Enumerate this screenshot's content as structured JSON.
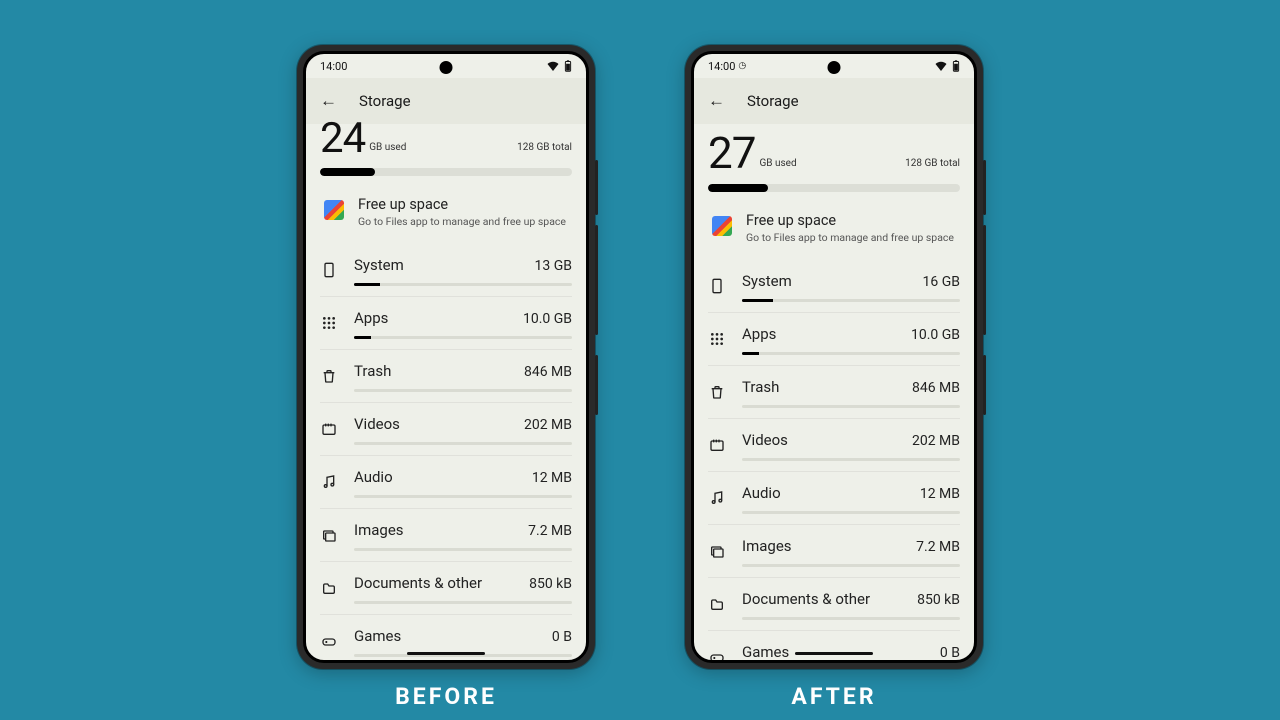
{
  "labels": {
    "before": "BEFORE",
    "after": "AFTER"
  },
  "phones": {
    "before": {
      "time": "14:00",
      "showClockIcon": false,
      "title": "Storage",
      "used_num": "24",
      "used_label": "GB used",
      "total": "128 GB total",
      "progress_pct": 22,
      "free_up": {
        "title": "Free up space",
        "subtitle": "Go to Files app to manage and free up space"
      },
      "categories": [
        {
          "name": "System",
          "size": "13 GB",
          "bar": 12,
          "icon": "system"
        },
        {
          "name": "Apps",
          "size": "10.0 GB",
          "bar": 8,
          "icon": "apps"
        },
        {
          "name": "Trash",
          "size": "846 MB",
          "bar": 0,
          "icon": "trash"
        },
        {
          "name": "Videos",
          "size": "202 MB",
          "bar": 0,
          "icon": "video"
        },
        {
          "name": "Audio",
          "size": "12 MB",
          "bar": 0,
          "icon": "audio"
        },
        {
          "name": "Images",
          "size": "7.2 MB",
          "bar": 0,
          "icon": "image"
        },
        {
          "name": "Documents & other",
          "size": "850 kB",
          "bar": 0,
          "icon": "doc"
        },
        {
          "name": "Games",
          "size": "0 B",
          "bar": 0,
          "icon": "game"
        }
      ]
    },
    "after": {
      "time": "14:00",
      "showClockIcon": true,
      "title": "Storage",
      "used_num": "27",
      "used_label": "GB used",
      "total": "128 GB total",
      "progress_pct": 24,
      "free_up": {
        "title": "Free up space",
        "subtitle": "Go to Files app to manage and free up space"
      },
      "categories": [
        {
          "name": "System",
          "size": "16 GB",
          "bar": 14,
          "icon": "system"
        },
        {
          "name": "Apps",
          "size": "10.0 GB",
          "bar": 8,
          "icon": "apps"
        },
        {
          "name": "Trash",
          "size": "846 MB",
          "bar": 0,
          "icon": "trash"
        },
        {
          "name": "Videos",
          "size": "202 MB",
          "bar": 0,
          "icon": "video"
        },
        {
          "name": "Audio",
          "size": "12 MB",
          "bar": 0,
          "icon": "audio"
        },
        {
          "name": "Images",
          "size": "7.2 MB",
          "bar": 0,
          "icon": "image"
        },
        {
          "name": "Documents & other",
          "size": "850 kB",
          "bar": 0,
          "icon": "doc"
        },
        {
          "name": "Games",
          "size": "0 B",
          "bar": 0,
          "icon": "game"
        }
      ]
    }
  }
}
